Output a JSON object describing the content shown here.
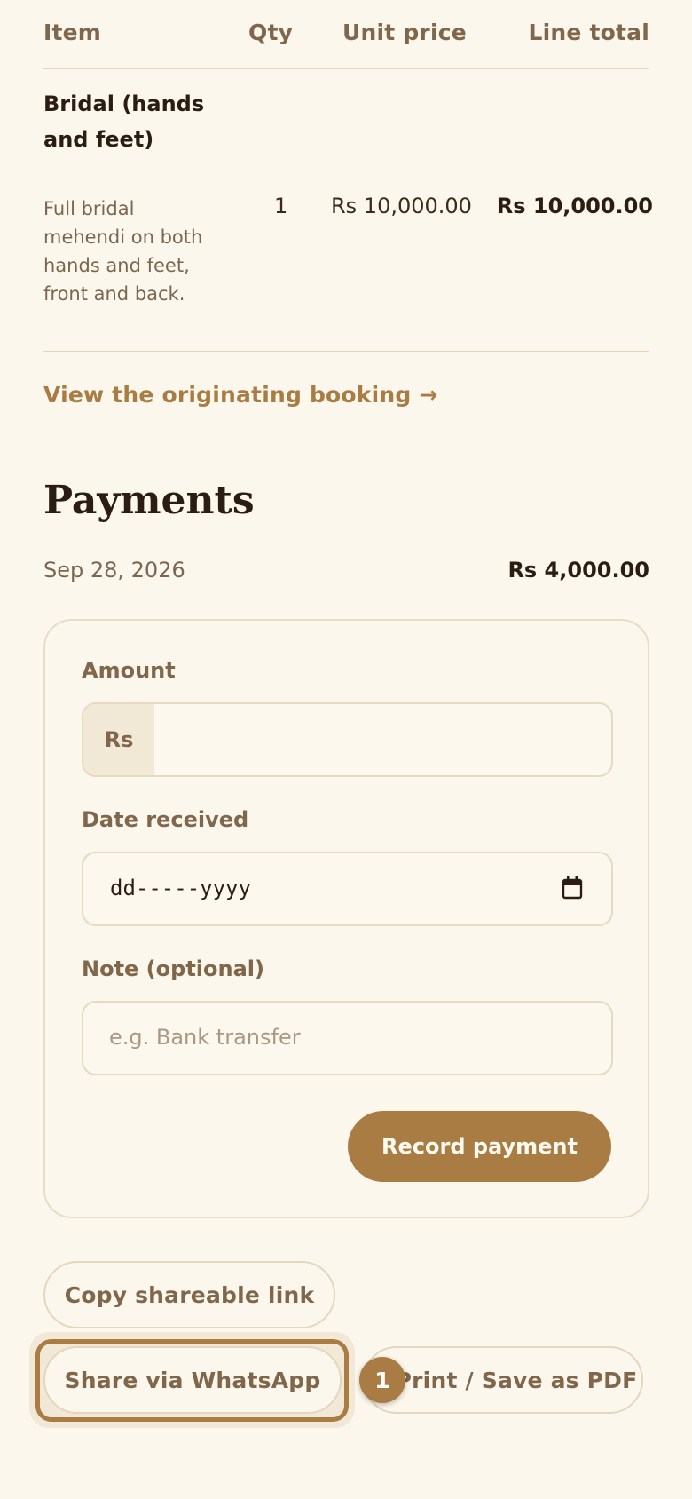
{
  "table": {
    "headers": {
      "item": "Item",
      "qty": "Qty",
      "unit_price": "Unit price",
      "line_total": "Line total"
    },
    "rows": [
      {
        "name": "Bridal (hands and feet)",
        "description": "Full bridal mehendi on both hands and feet, front and back.",
        "qty": "1",
        "unit_price": "Rs 10,000.00",
        "line_total": "Rs 10,000.00"
      }
    ]
  },
  "booking_link": "View the originating booking →",
  "payments": {
    "title": "Payments",
    "entries": [
      {
        "date": "Sep 28, 2026",
        "amount": "Rs 4,000.00"
      }
    ],
    "form": {
      "amount_label": "Amount",
      "currency_prefix": "Rs",
      "amount_value": "",
      "date_label": "Date received",
      "date_value": "dd-----yyyy",
      "note_label": "Note (optional)",
      "note_placeholder": "e.g. Bank transfer",
      "submit_label": "Record payment"
    }
  },
  "actions": {
    "copy_link": "Copy shareable link",
    "whatsapp": "Share via WhatsApp",
    "print_pdf": "Print / Save as PDF"
  },
  "badge": "1",
  "colors": {
    "accent": "#a87c42",
    "background": "#fcf7ec",
    "border": "#e3d7bd",
    "text": "#2b1d12",
    "muted": "#80664a"
  },
  "icons": {
    "date_picker": "calendar-icon"
  }
}
